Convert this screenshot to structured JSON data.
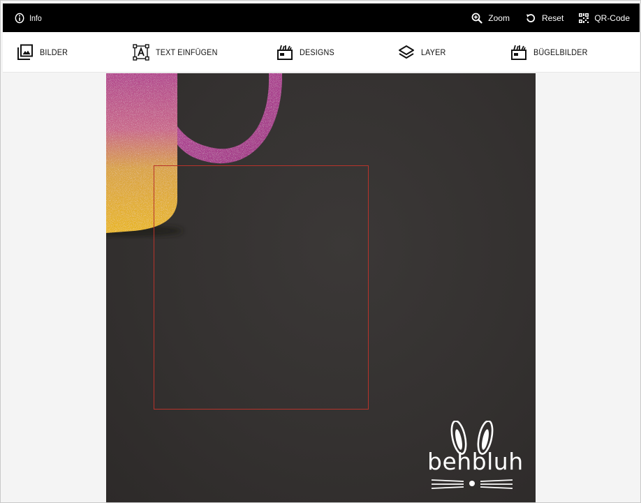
{
  "topbar": {
    "info_label": "Info",
    "zoom_label": "Zoom",
    "reset_label": "Reset",
    "qr_label": "QR-Code"
  },
  "toolbar": {
    "items": [
      {
        "label": "BILDER",
        "icon": "images-icon"
      },
      {
        "label": "TEXT EINFÜGEN",
        "icon": "text-box-icon"
      },
      {
        "label": "DESIGNS",
        "icon": "designs-box-icon"
      },
      {
        "label": "LAYER",
        "icon": "layers-icon"
      },
      {
        "label": "BÜGELBILDER",
        "icon": "designs-box-icon"
      }
    ]
  },
  "canvas": {
    "logo_text": "behbluh"
  },
  "colors": {
    "topbar_bg": "#000000",
    "print_area_border": "#b8332b",
    "product_bg": "#343130",
    "mug_pink": "#b0408f",
    "mug_gold": "#e0b12c"
  }
}
